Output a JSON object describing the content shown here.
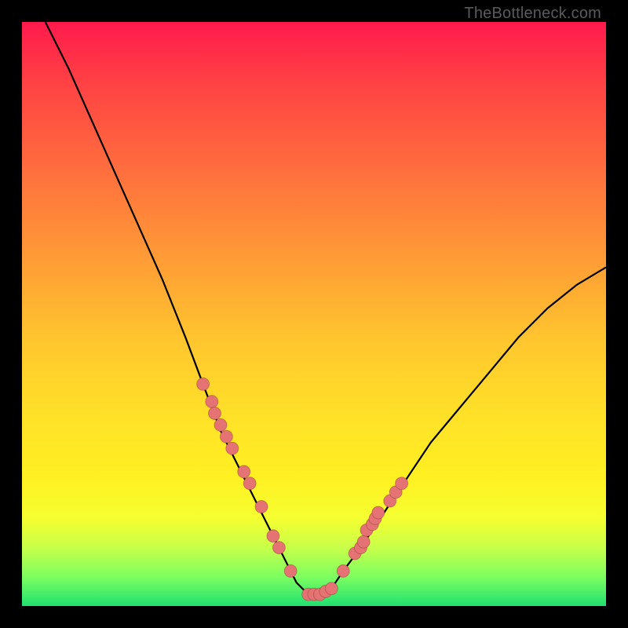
{
  "attribution": "TheBottleneck.com",
  "chart_data": {
    "type": "line",
    "title": "",
    "xlabel": "",
    "ylabel": "",
    "xlim": [
      0,
      100
    ],
    "ylim": [
      0,
      100
    ],
    "grid": false,
    "series": [
      {
        "name": "bottleneck-curve",
        "x": [
          4,
          8,
          12,
          16,
          20,
          24,
          28,
          31,
          34,
          37,
          40,
          43,
          45,
          47,
          49,
          51,
          53,
          55,
          58,
          62,
          66,
          70,
          75,
          80,
          85,
          90,
          95,
          100
        ],
        "values": [
          100,
          92,
          83,
          74,
          65,
          56,
          46,
          38,
          30,
          24,
          18,
          12,
          8,
          4,
          2,
          2,
          3,
          6,
          10,
          16,
          22,
          28,
          34,
          40,
          46,
          51,
          55,
          58
        ]
      }
    ],
    "marker_points": {
      "name": "highlight-dots",
      "x": [
        31.0,
        32.5,
        33.0,
        34.0,
        35.0,
        36.0,
        38.0,
        39.0,
        41.0,
        43.0,
        44.0,
        46.0,
        49.0,
        50.0,
        51.0,
        52.0,
        53.0,
        55.0,
        57.0,
        58.0,
        58.5,
        59.0,
        60.0,
        60.5,
        61.0,
        63.0,
        64.0,
        65.0
      ],
      "values": [
        38.0,
        35.0,
        33.0,
        31.0,
        29.0,
        27.0,
        23.0,
        21.0,
        17.0,
        12.0,
        10.0,
        6.0,
        2.0,
        2.0,
        2.0,
        2.5,
        3.0,
        6.0,
        9.0,
        10.0,
        11.0,
        13.0,
        14.0,
        15.0,
        16.0,
        18.0,
        19.5,
        21.0
      ]
    },
    "gradient_stops": [
      {
        "pos": 0,
        "color": "#ff1a4d"
      },
      {
        "pos": 25,
        "color": "#ff7a3a"
      },
      {
        "pos": 55,
        "color": "#ffc72e"
      },
      {
        "pos": 80,
        "color": "#fff525"
      },
      {
        "pos": 100,
        "color": "#20e070"
      }
    ]
  }
}
